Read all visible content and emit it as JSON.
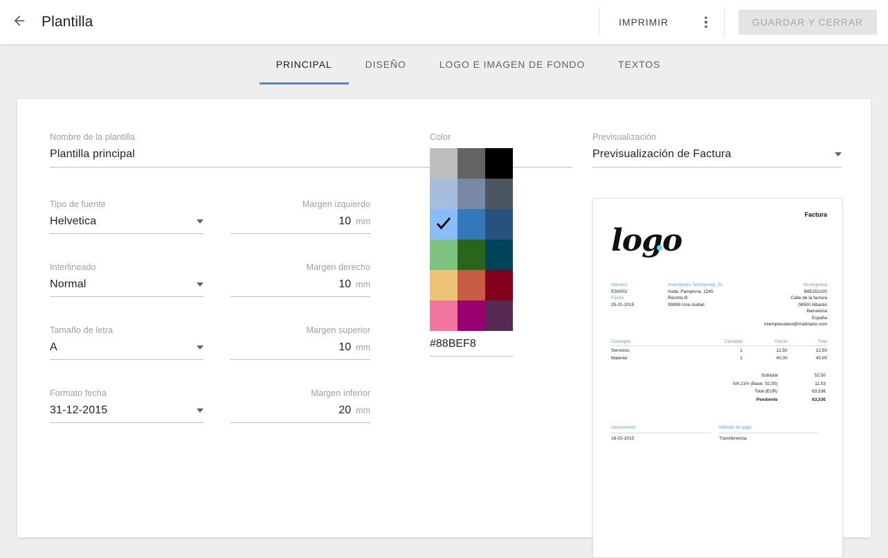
{
  "appbar": {
    "back_icon": "arrow-left-icon",
    "title": "Plantilla",
    "print_label": "IMPRIMIR",
    "menu_icon": "more-vertical-icon",
    "save_label": "GUARDAR Y CERRAR"
  },
  "tabs": [
    {
      "label": "PRINCIPAL",
      "active": true
    },
    {
      "label": "DISEÑO",
      "active": false
    },
    {
      "label": "LOGO E IMAGEN DE FONDO",
      "active": false
    },
    {
      "label": "TEXTOS",
      "active": false
    }
  ],
  "accent_color": "#4285f4",
  "form": {
    "template_name": {
      "label": "Nombre de la plantilla",
      "value": "Plantilla principal"
    },
    "font_type": {
      "label": "Tipo de fuente",
      "value": "Helvetica"
    },
    "line_spacing": {
      "label": "Interlineado",
      "value": "Normal"
    },
    "font_size": {
      "label": "Tamaño de letra",
      "value": "A"
    },
    "date_format": {
      "label": "Formato fecha",
      "value": "31-12-2015"
    },
    "margin_left": {
      "label": "Margen izquierdo",
      "value": "10",
      "unit": "mm"
    },
    "margin_right": {
      "label": "Margen derecho",
      "value": "10",
      "unit": "mm"
    },
    "margin_top": {
      "label": "Margen superior",
      "value": "10",
      "unit": "mm"
    },
    "margin_bottom": {
      "label": "Margen inferior",
      "value": "20",
      "unit": "mm"
    }
  },
  "color": {
    "label": "Color",
    "hex_value": "#88BEF8",
    "selected_index": 6,
    "swatches": [
      "#bdbdbd",
      "#636363",
      "#000000",
      "#a7bdde",
      "#7889a4",
      "#4a5761",
      "#88bef8",
      "#3378b8",
      "#27527d",
      "#7fc280",
      "#2a651c",
      "#00445a",
      "#edc377",
      "#c75b44",
      "#84001f",
      "#f2759f",
      "#99006e",
      "#562a52"
    ]
  },
  "preview": {
    "label": "Previsualización",
    "value": "Previsualización de Factura",
    "document": {
      "title": "Factura",
      "logo_text": "logo",
      "meta_left": [
        {
          "text": "Número",
          "blue": true
        },
        {
          "text": "ES0002",
          "blue": false
        },
        {
          "text": "Fecha",
          "blue": true
        },
        {
          "text": "25-01-2015",
          "blue": false
        }
      ],
      "meta_center": [
        {
          "text": "Inversiones Technycorp, SL",
          "blue": true
        },
        {
          "text": "Avda. Pamplona, 1245",
          "blue": false
        },
        {
          "text": "Recinto B",
          "blue": false
        },
        {
          "text": "99999 Una ciudad",
          "blue": false
        }
      ],
      "meta_right": [
        {
          "text": "Mi empresa",
          "blue": true
        },
        {
          "text": "B65152100",
          "blue": false
        },
        {
          "text": "Calle de la factura",
          "blue": false
        },
        {
          "text": "08500 Albarán",
          "blue": false
        },
        {
          "text": "Barcelona",
          "blue": false
        },
        {
          "text": "España",
          "blue": false
        },
        {
          "text": "miempresatest@mailinator.com",
          "blue": false
        }
      ],
      "items_headers": [
        "Concepto",
        "Cantidad",
        "Precio",
        "Total"
      ],
      "items_rows": [
        [
          "Servicios",
          "1",
          "12,50",
          "12,50"
        ],
        [
          "Material",
          "1",
          "40,00",
          "40,00"
        ]
      ],
      "totals": [
        {
          "label": "Subtotal",
          "value": "52,50",
          "bold": false
        },
        {
          "label": "IVA 21% (Base: 52,50)",
          "value": "11,03",
          "bold": false
        },
        {
          "label": "Total (EUR)",
          "value": "63,53€",
          "bold": false
        },
        {
          "label": "Pendiente",
          "value": "63,53€",
          "bold": true
        }
      ],
      "due_label": "Vencimiento",
      "due_value": "16-02-2015",
      "payment_label": "Método de pago",
      "payment_value": "Transferencia"
    }
  }
}
